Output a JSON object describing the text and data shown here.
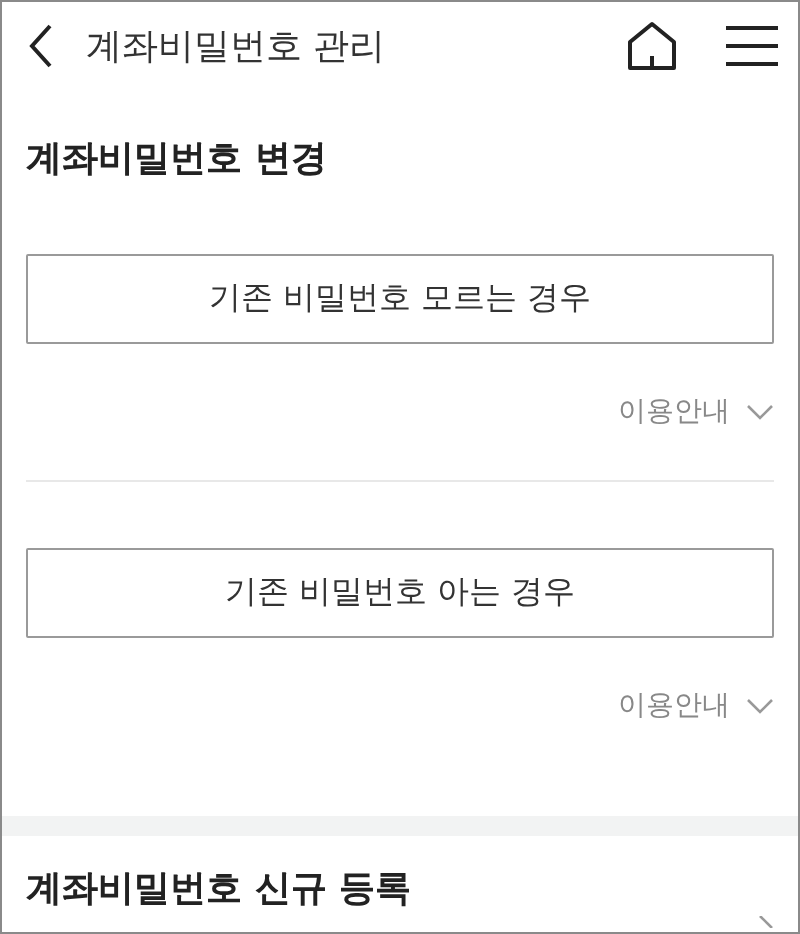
{
  "header": {
    "title": "계좌비밀번호 관리"
  },
  "sections": [
    {
      "title": "계좌비밀번호 변경",
      "options": [
        {
          "label": "기존 비밀번호 모르는 경우",
          "info": "이용안내",
          "expanded": false
        },
        {
          "label": "기존 비밀번호 아는 경우",
          "info": "이용안내",
          "expanded": false
        }
      ]
    },
    {
      "title": "계좌비밀번호 신규 등록",
      "chevron": true
    }
  ]
}
